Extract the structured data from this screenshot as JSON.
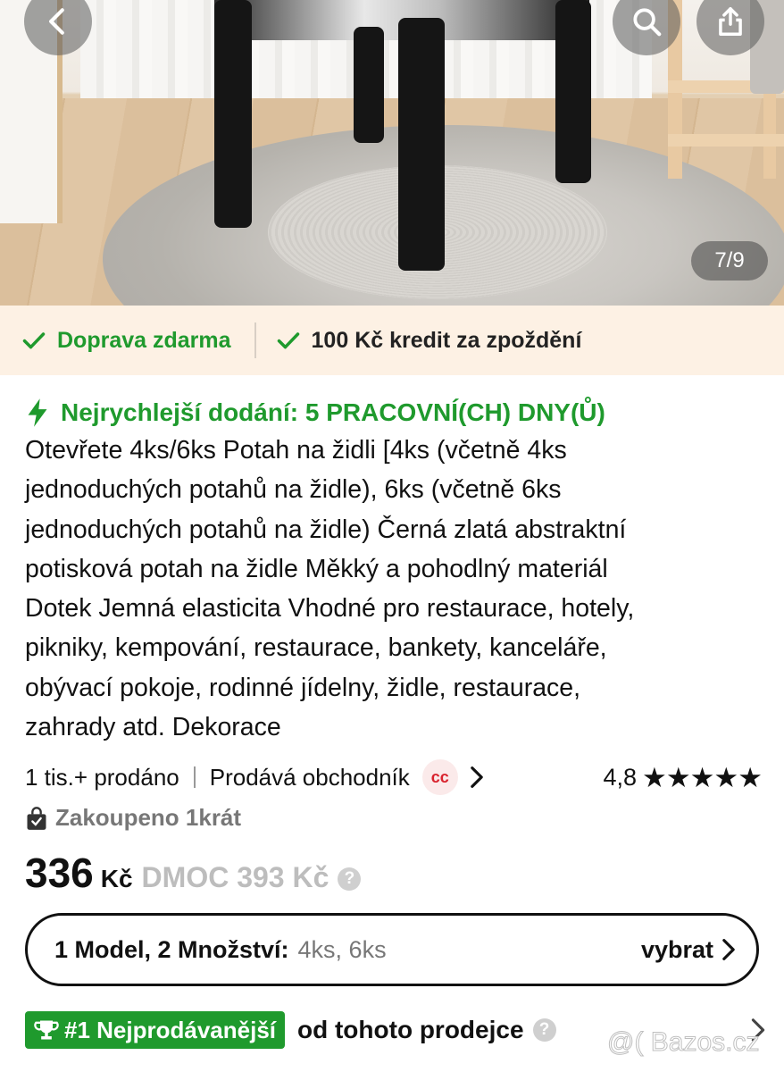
{
  "gallery": {
    "counter": "7/9",
    "back_icon": "chevron-left-icon",
    "search_icon": "search-icon",
    "share_icon": "share-icon"
  },
  "benefits": {
    "free_shipping": "Doprava zdarma",
    "delay_credit": "100 Kč kredit za zpoždění",
    "icon": "check-icon",
    "accent": "#1f9a2d"
  },
  "product": {
    "delivery": "Nejrychlejší dodání: 5 PRACOVNÍ(CH) DNY(Ů)",
    "title_lines": [
      "Otevřete 4ks/6ks Potah na židli [4ks (včetně 4ks",
      "jednoduchých potahů na židle), 6ks (včetně 6ks",
      "jednoduchých potahů na židle) Černá zlatá abstraktní",
      "potisková potah na židle Měkký a pohodlný materiál",
      "Dotek Jemná elasticita Vhodné pro restaurace, hotely,",
      "pikniky, kempování, restaurace, bankety, kanceláře,",
      "obývací pokoje, rodinné jídelny, židle, restaurace,",
      "zahrady atd. Dekorace"
    ],
    "sold": "1 tis.+ prodáno",
    "seller_label": "Prodává obchodník",
    "seller_badge": "cc",
    "rating": "4,8",
    "stars": 5,
    "bought": "Zakoupeno 1krát",
    "price": "336",
    "currency": "Kč",
    "rrp": "DMOC 393 Kč",
    "help": "?"
  },
  "variant": {
    "label": "1 Model, 2 Množství:",
    "options": "4ks, 6ks",
    "pick": "vybrat"
  },
  "bestseller": {
    "badge": "#1 Nejprodávanější",
    "text": "od tohoto prodejce"
  },
  "watermark": "@( Bazos.cz"
}
